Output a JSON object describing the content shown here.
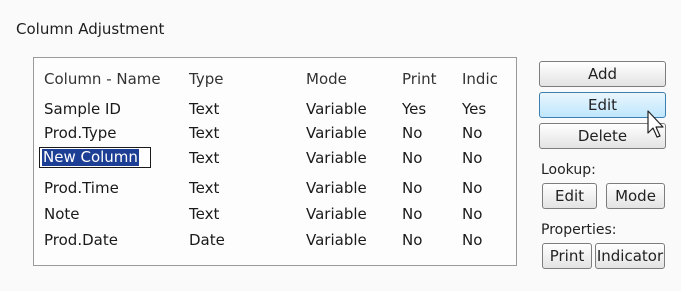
{
  "group": {
    "title": "Column Adjustment"
  },
  "list": {
    "columns": [
      "Column - Name",
      "Type",
      "Mode",
      "Print",
      "Indic"
    ],
    "rows": [
      {
        "name": "Sample ID",
        "type": "Text",
        "mode": "Variable",
        "print": "Yes",
        "indic": "Yes"
      },
      {
        "name": "Prod.Type",
        "type": "Text",
        "mode": "Variable",
        "print": "No",
        "indic": "No"
      },
      {
        "name": "New Column",
        "type": "Text",
        "mode": "Variable",
        "print": "No",
        "indic": "No",
        "editing": true
      },
      {
        "name": "Prod.Time",
        "type": "Text",
        "mode": "Variable",
        "print": "No",
        "indic": "No"
      },
      {
        "name": "Note",
        "type": "Text",
        "mode": "Variable",
        "print": "No",
        "indic": "No"
      },
      {
        "name": "Prod.Date",
        "type": "Date",
        "mode": "Variable",
        "print": "No",
        "indic": "No"
      }
    ]
  },
  "buttons": {
    "add": "Add",
    "edit": "Edit",
    "delete": "Delete"
  },
  "lookup": {
    "label": "Lookup:",
    "edit": "Edit",
    "mode": "Mode"
  },
  "properties": {
    "label": "Properties:",
    "print": "Print",
    "indicator": "Indicator"
  },
  "icons": {
    "cursor": "arrow-cursor-icon"
  }
}
